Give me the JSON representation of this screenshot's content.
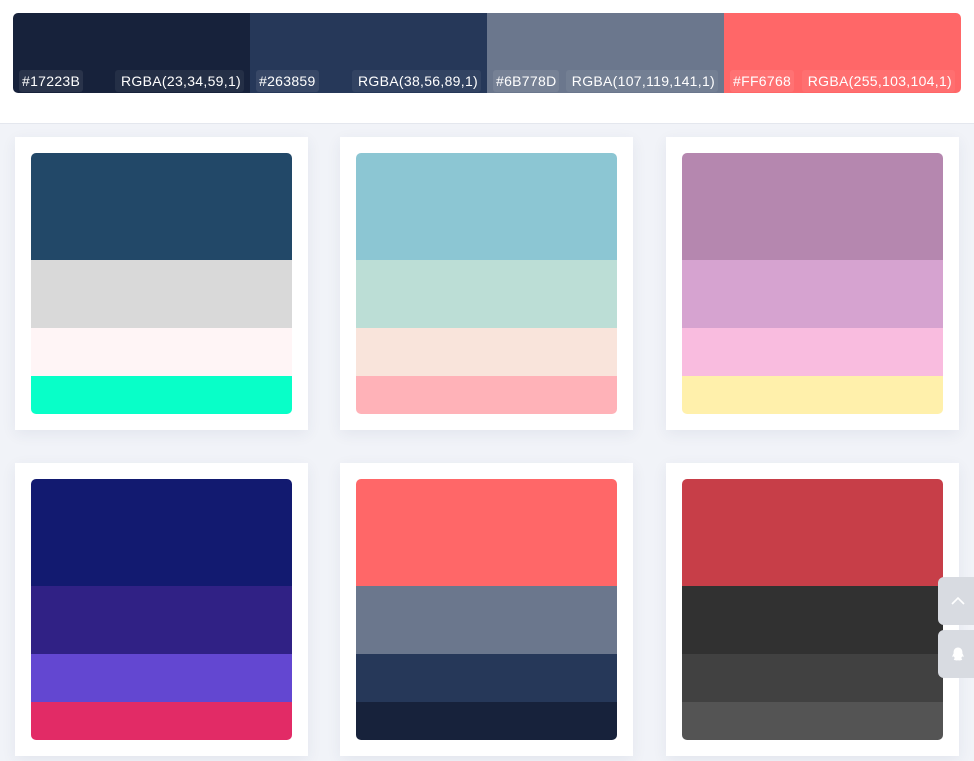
{
  "main_palette": [
    {
      "hex": "#17223B",
      "rgba": "RGBA(23,34,59,1)",
      "color": "#17223B"
    },
    {
      "hex": "#263859",
      "rgba": "RGBA(38,56,89,1)",
      "color": "#263859"
    },
    {
      "hex": "#6B778D",
      "rgba": "RGBA(107,119,141,1)",
      "color": "#6B778D"
    },
    {
      "hex": "#FF6768",
      "rgba": "RGBA(255,103,104,1)",
      "color": "#FF6768"
    }
  ],
  "palettes": [
    {
      "colors": [
        "#224868",
        "#d9d9d9",
        "#fff5f6",
        "#08ffc8"
      ]
    },
    {
      "colors": [
        "#8cc6d3",
        "#bcded6",
        "#f9e4db",
        "#ffb2b8"
      ]
    },
    {
      "colors": [
        "#b587af",
        "#d6a3d0",
        "#f9bcdf",
        "#fff0ab"
      ]
    },
    {
      "colors": [
        "#121a70",
        "#302185",
        "#6347d1",
        "#e22b66"
      ]
    },
    {
      "colors": [
        "#ff6768",
        "#6b778d",
        "#263859",
        "#17223b"
      ]
    },
    {
      "colors": [
        "#c73e48",
        "#313131",
        "#414141",
        "#545454"
      ]
    }
  ],
  "side_buttons": {
    "top_icon": "chevron-up-icon",
    "qq_icon": "qq-icon"
  }
}
